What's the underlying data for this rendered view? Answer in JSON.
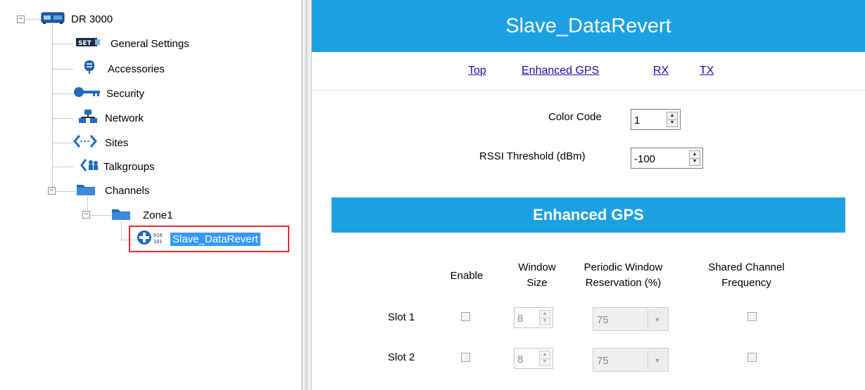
{
  "tree": {
    "root": "DR 3000",
    "items": [
      {
        "label": "General Settings",
        "icon": "set-icon"
      },
      {
        "label": "Accessories",
        "icon": "microphone-icon"
      },
      {
        "label": "Security",
        "icon": "key-icon"
      },
      {
        "label": "Network",
        "icon": "network-icon"
      },
      {
        "label": "Sites",
        "icon": "sites-icon"
      },
      {
        "label": "Talkgroups",
        "icon": "talkgroups-icon"
      },
      {
        "label": "Channels",
        "icon": "folder-icon"
      }
    ],
    "zone": "Zone1",
    "channel": "Slave_DataRevert",
    "set_icon_text": "SET"
  },
  "header": {
    "title": "Slave_DataRevert"
  },
  "nav": {
    "links": [
      "Top",
      "Enhanced GPS",
      "RX",
      "TX"
    ]
  },
  "fields": {
    "color_code": {
      "label": "Color Code",
      "value": "1"
    },
    "rssi": {
      "label": "RSSI Threshold (dBm)",
      "value": "-100"
    }
  },
  "enhanced_gps": {
    "title": "Enhanced GPS",
    "columns": {
      "enable": "Enable",
      "window_size": [
        "Window",
        "Size"
      ],
      "reservation": [
        "Periodic Window",
        "Reservation (%)"
      ],
      "shared": [
        "Shared Channel",
        "Frequency"
      ]
    },
    "rows": [
      {
        "label": "Slot 1",
        "enable": false,
        "window_size": "8",
        "reservation": "75",
        "shared": false
      },
      {
        "label": "Slot 2",
        "enable": false,
        "window_size": "8",
        "reservation": "75",
        "shared": false
      }
    ]
  },
  "colors": {
    "accent": "#1ba1e2",
    "selection": "#3399ff",
    "highlight_border": "#e8262f",
    "link": "#1a0dab"
  }
}
